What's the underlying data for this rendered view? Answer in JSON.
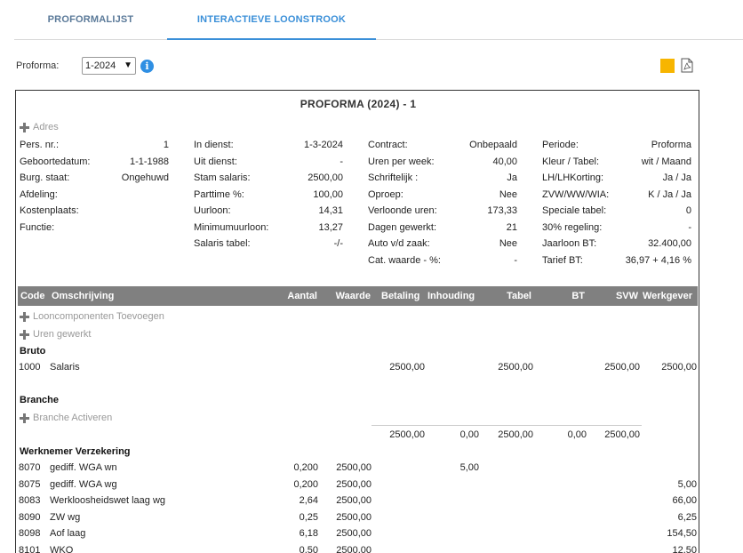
{
  "tabs": [
    {
      "label": "PROFORMALIJST",
      "active": false
    },
    {
      "label": "INTERACTIEVE LOONSTROOK",
      "active": true
    }
  ],
  "proforma": {
    "label": "Proforma:",
    "selected": "1-2024"
  },
  "colors": {
    "accent": "#3a8fd8",
    "export": "#f7b500",
    "header_bg": "#808080"
  },
  "document": {
    "title": "PROFORMA (2024) - 1",
    "address_link": "Adres",
    "info": {
      "col1": [
        {
          "label": "Pers. nr.:",
          "value": "1"
        },
        {
          "label": "Geboortedatum:",
          "value": "1-1-1988"
        },
        {
          "label": "Burg. staat:",
          "value": "Ongehuwd"
        },
        {
          "label": "Afdeling:",
          "value": ""
        },
        {
          "label": "Kostenplaats:",
          "value": ""
        },
        {
          "label": "Functie:",
          "value": ""
        }
      ],
      "col2": [
        {
          "label": "In dienst:",
          "value": "1-3-2024"
        },
        {
          "label": "Uit dienst:",
          "value": "-"
        },
        {
          "label": "Stam salaris:",
          "value": "2500,00"
        },
        {
          "label": "Parttime %:",
          "value": "100,00"
        },
        {
          "label": "Uurloon:",
          "value": "14,31"
        },
        {
          "label": "Minimumuurloon:",
          "value": "13,27"
        },
        {
          "label": "Salaris tabel:",
          "value": "-/-"
        }
      ],
      "col3": [
        {
          "label": "Contract:",
          "value": "Onbepaald"
        },
        {
          "label": "Uren per week:",
          "value": "40,00"
        },
        {
          "label": "Schriftelijk :",
          "value": "Ja"
        },
        {
          "label": "Oproep:",
          "value": "Nee"
        },
        {
          "label": "Verloonde uren:",
          "value": "173,33"
        },
        {
          "label": "Dagen gewerkt:",
          "value": "21"
        },
        {
          "label": "Auto v/d zaak:",
          "value": "Nee"
        },
        {
          "label": "Cat. waarde - %:",
          "value": "-"
        }
      ],
      "col4": [
        {
          "label": "Periode:",
          "value": "Proforma"
        },
        {
          "label": "Kleur / Tabel:",
          "value": "wit / Maand"
        },
        {
          "label": "LH/LHKorting:",
          "value": "Ja / Ja"
        },
        {
          "label": "ZVW/WW/WIA:",
          "value": "K / Ja / Ja"
        },
        {
          "label": "Speciale tabel:",
          "value": "0"
        },
        {
          "label": "30% regeling:",
          "value": "-"
        },
        {
          "label": "Jaarloon BT:",
          "value": "32.400,00"
        },
        {
          "label": "Tarief BT:",
          "value": "36,97 + 4,16 %"
        }
      ]
    },
    "table": {
      "headers": {
        "code": "Code",
        "omschrijving": "Omschrijving",
        "aantal": "Aantal",
        "waarde": "Waarde",
        "betaling": "Betaling",
        "inhouding": "Inhouding",
        "tabel": "Tabel",
        "bt": "BT",
        "svw": "SVW",
        "werkgever": "Werkgever"
      },
      "add_looncomponenten": "Looncomponenten Toevoegen",
      "add_uren": "Uren gewerkt",
      "bruto_title": "Bruto",
      "bruto_row": {
        "code": "1000",
        "omschrijving": "Salaris",
        "betaling": "2500,00",
        "tabel": "2500,00",
        "svw": "2500,00",
        "werkgever": "2500,00"
      },
      "branche_title": "Branche",
      "add_branche": "Branche Activeren",
      "totals": {
        "betaling": "2500,00",
        "inhouding": "0,00",
        "tabel": "2500,00",
        "bt": "0,00",
        "svw": "2500,00"
      },
      "werknemer_title": "Werknemer Verzekering",
      "rows": [
        {
          "code": "8070",
          "omschrijving": "gediff. WGA wn",
          "aantal": "0,200",
          "waarde": "2500,00",
          "inhouding": "5,00",
          "werkgever": ""
        },
        {
          "code": "8075",
          "omschrijving": "gediff. WGA wg",
          "aantal": "0,200",
          "waarde": "2500,00",
          "inhouding": "",
          "werkgever": "5,00"
        },
        {
          "code": "8083",
          "omschrijving": "Werkloosheidswet laag wg",
          "aantal": "2,64",
          "waarde": "2500,00",
          "inhouding": "",
          "werkgever": "66,00"
        },
        {
          "code": "8090",
          "omschrijving": "ZW wg",
          "aantal": "0,25",
          "waarde": "2500,00",
          "inhouding": "",
          "werkgever": "6,25"
        },
        {
          "code": "8098",
          "omschrijving": "Aof laag",
          "aantal": "6,18",
          "waarde": "2500,00",
          "inhouding": "",
          "werkgever": "154,50"
        },
        {
          "code": "8101",
          "omschrijving": "WKO",
          "aantal": "0,50",
          "waarde": "2500,00",
          "inhouding": "",
          "werkgever": "12,50"
        }
      ]
    }
  }
}
